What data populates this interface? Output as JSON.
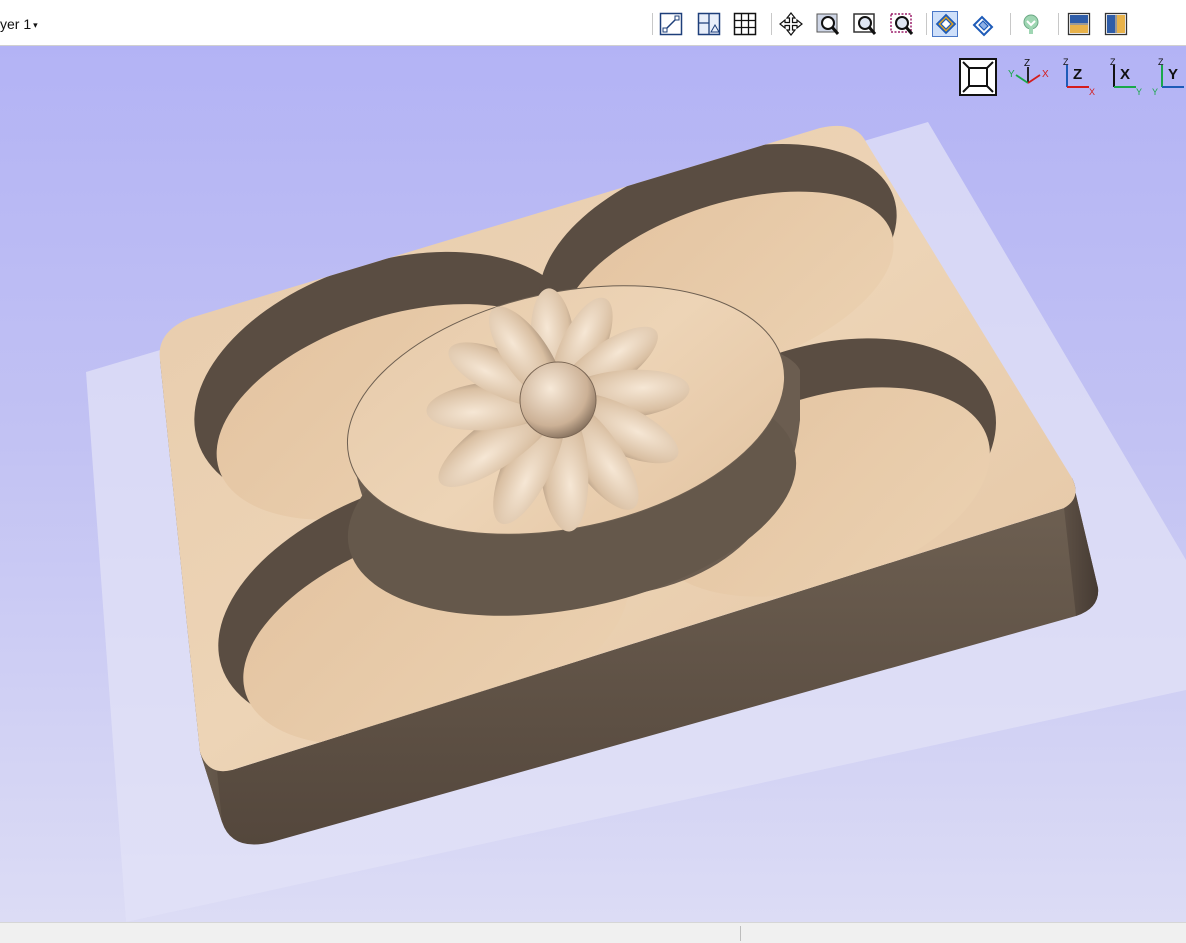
{
  "toolbar": {
    "layer_label": "yer 1",
    "layer_caret": "▾",
    "icons": [
      "draw-2d-view-icon",
      "split-view-icon",
      "grid-icon",
      "pan-icon",
      "zoom-box-icon",
      "zoom-extents-icon",
      "zoom-selection-icon",
      "show-model-icon",
      "toolpath-preview-icon",
      "shaded-model-icon",
      "layout-horizontal-icon",
      "layout-vertical-icon"
    ]
  },
  "view_controls": {
    "icons": [
      "fit-view-icon",
      "iso-view-icon",
      "front-view-icon",
      "top-view-icon",
      "side-view-icon"
    ],
    "axes": {
      "iso": [
        "Y",
        "Z",
        "X"
      ],
      "front": [
        "Z",
        "Z",
        "X"
      ],
      "top": [
        "Z",
        "X",
        "Y"
      ],
      "side": [
        "Z",
        "Y",
        "Y"
      ]
    }
  },
  "colors": {
    "background_top": "#b3b3f5",
    "background_bottom": "#dcdcf5",
    "wood_surface": "#e6c9a8",
    "wood_wall": "#5f5145",
    "accent_blue": "#1e5bb8"
  }
}
